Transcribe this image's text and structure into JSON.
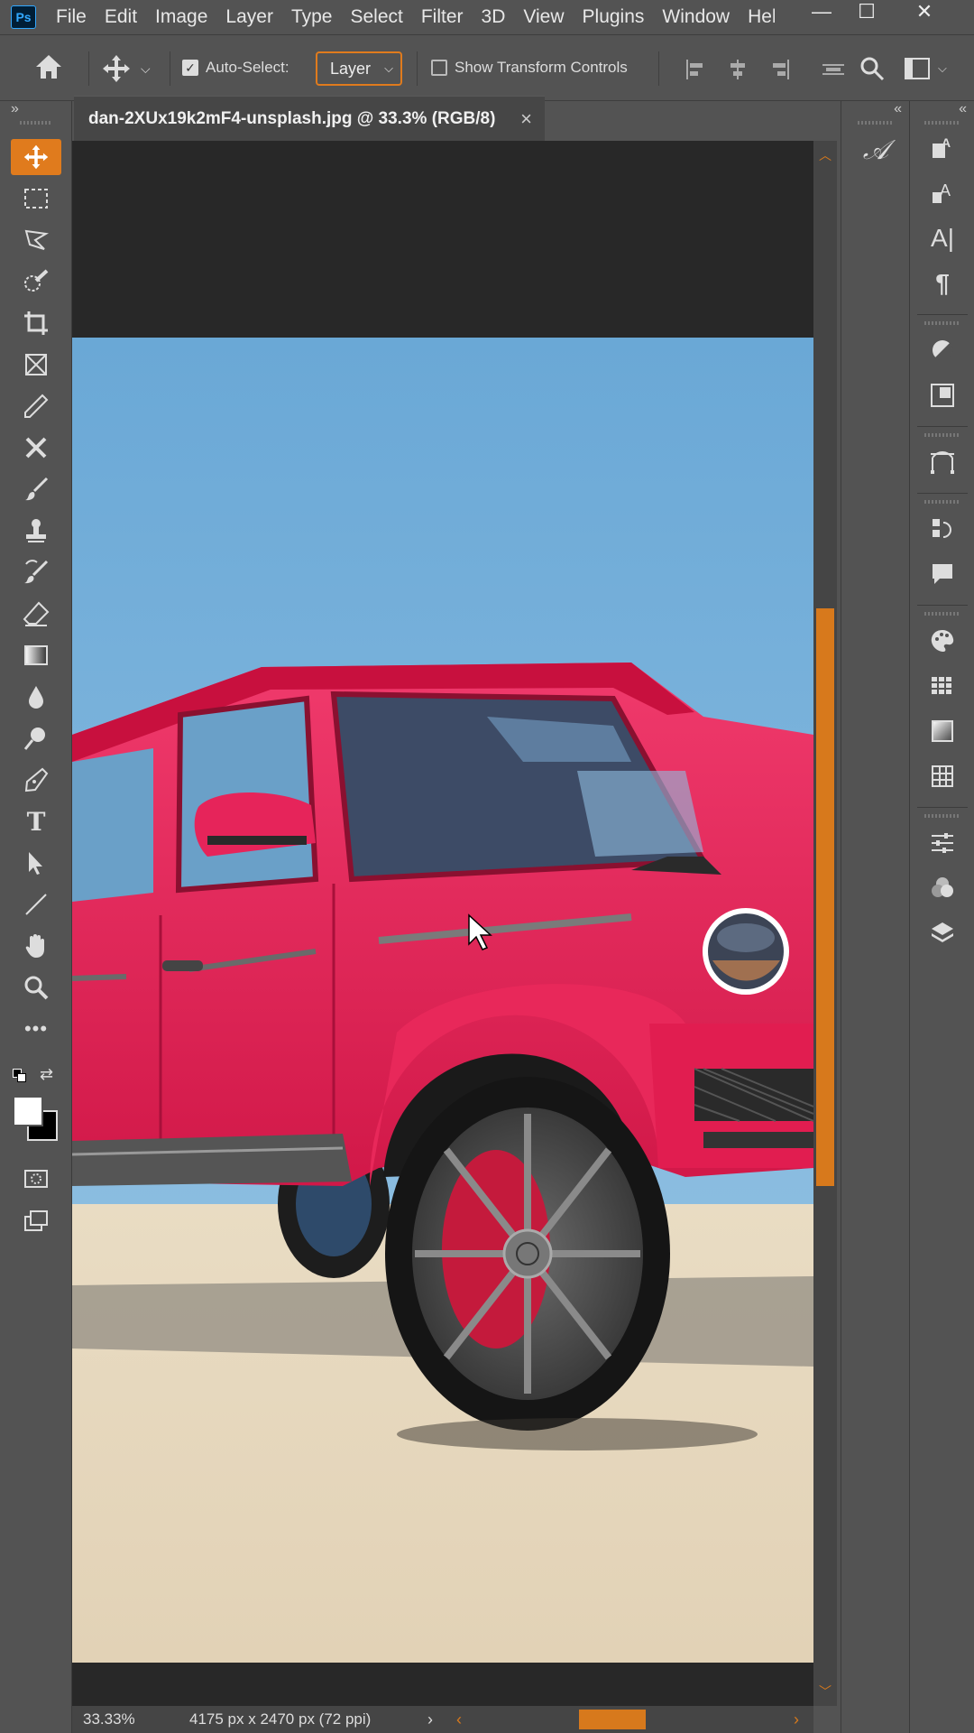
{
  "app": {
    "logo": "Ps"
  },
  "menu": [
    "File",
    "Edit",
    "Image",
    "Layer",
    "Type",
    "Select",
    "Filter",
    "3D",
    "View",
    "Plugins",
    "Window",
    "Hel"
  ],
  "window_controls": {
    "minimize": "—",
    "maximize": "☐",
    "close": "✕"
  },
  "options": {
    "auto_select_label": "Auto-Select:",
    "auto_select_checked": true,
    "layer_dropdown": "Layer",
    "transform_label": "Show Transform Controls",
    "transform_checked": false
  },
  "document_tab": {
    "title": "dan-2XUx19k2mF4-unsplash.jpg @ 33.3% (RGB/8)",
    "close": "×"
  },
  "tools": [
    "move-tool",
    "marquee-tool",
    "lasso-tool",
    "quick-selection-tool",
    "crop-tool",
    "frame-tool",
    "eyedropper-tool",
    "healing-tool",
    "brush-tool",
    "clone-stamp-tool",
    "history-brush-tool",
    "eraser-tool",
    "gradient-tool",
    "blur-tool",
    "dodge-tool",
    "pen-tool",
    "type-tool",
    "path-selection-tool",
    "line-tool",
    "hand-tool",
    "zoom-tool",
    "more-tools"
  ],
  "colors": {
    "accent": "#e07b1d",
    "foreground": "#ffffff",
    "background": "#000000",
    "panel": "#535353",
    "pasteboard": "#282828"
  },
  "status": {
    "zoom": "33.33%",
    "doc_size": "4175 px x 2470 px (72 ppi)"
  },
  "canvas_image": "red-mercedes-g-wagon-in-desert"
}
